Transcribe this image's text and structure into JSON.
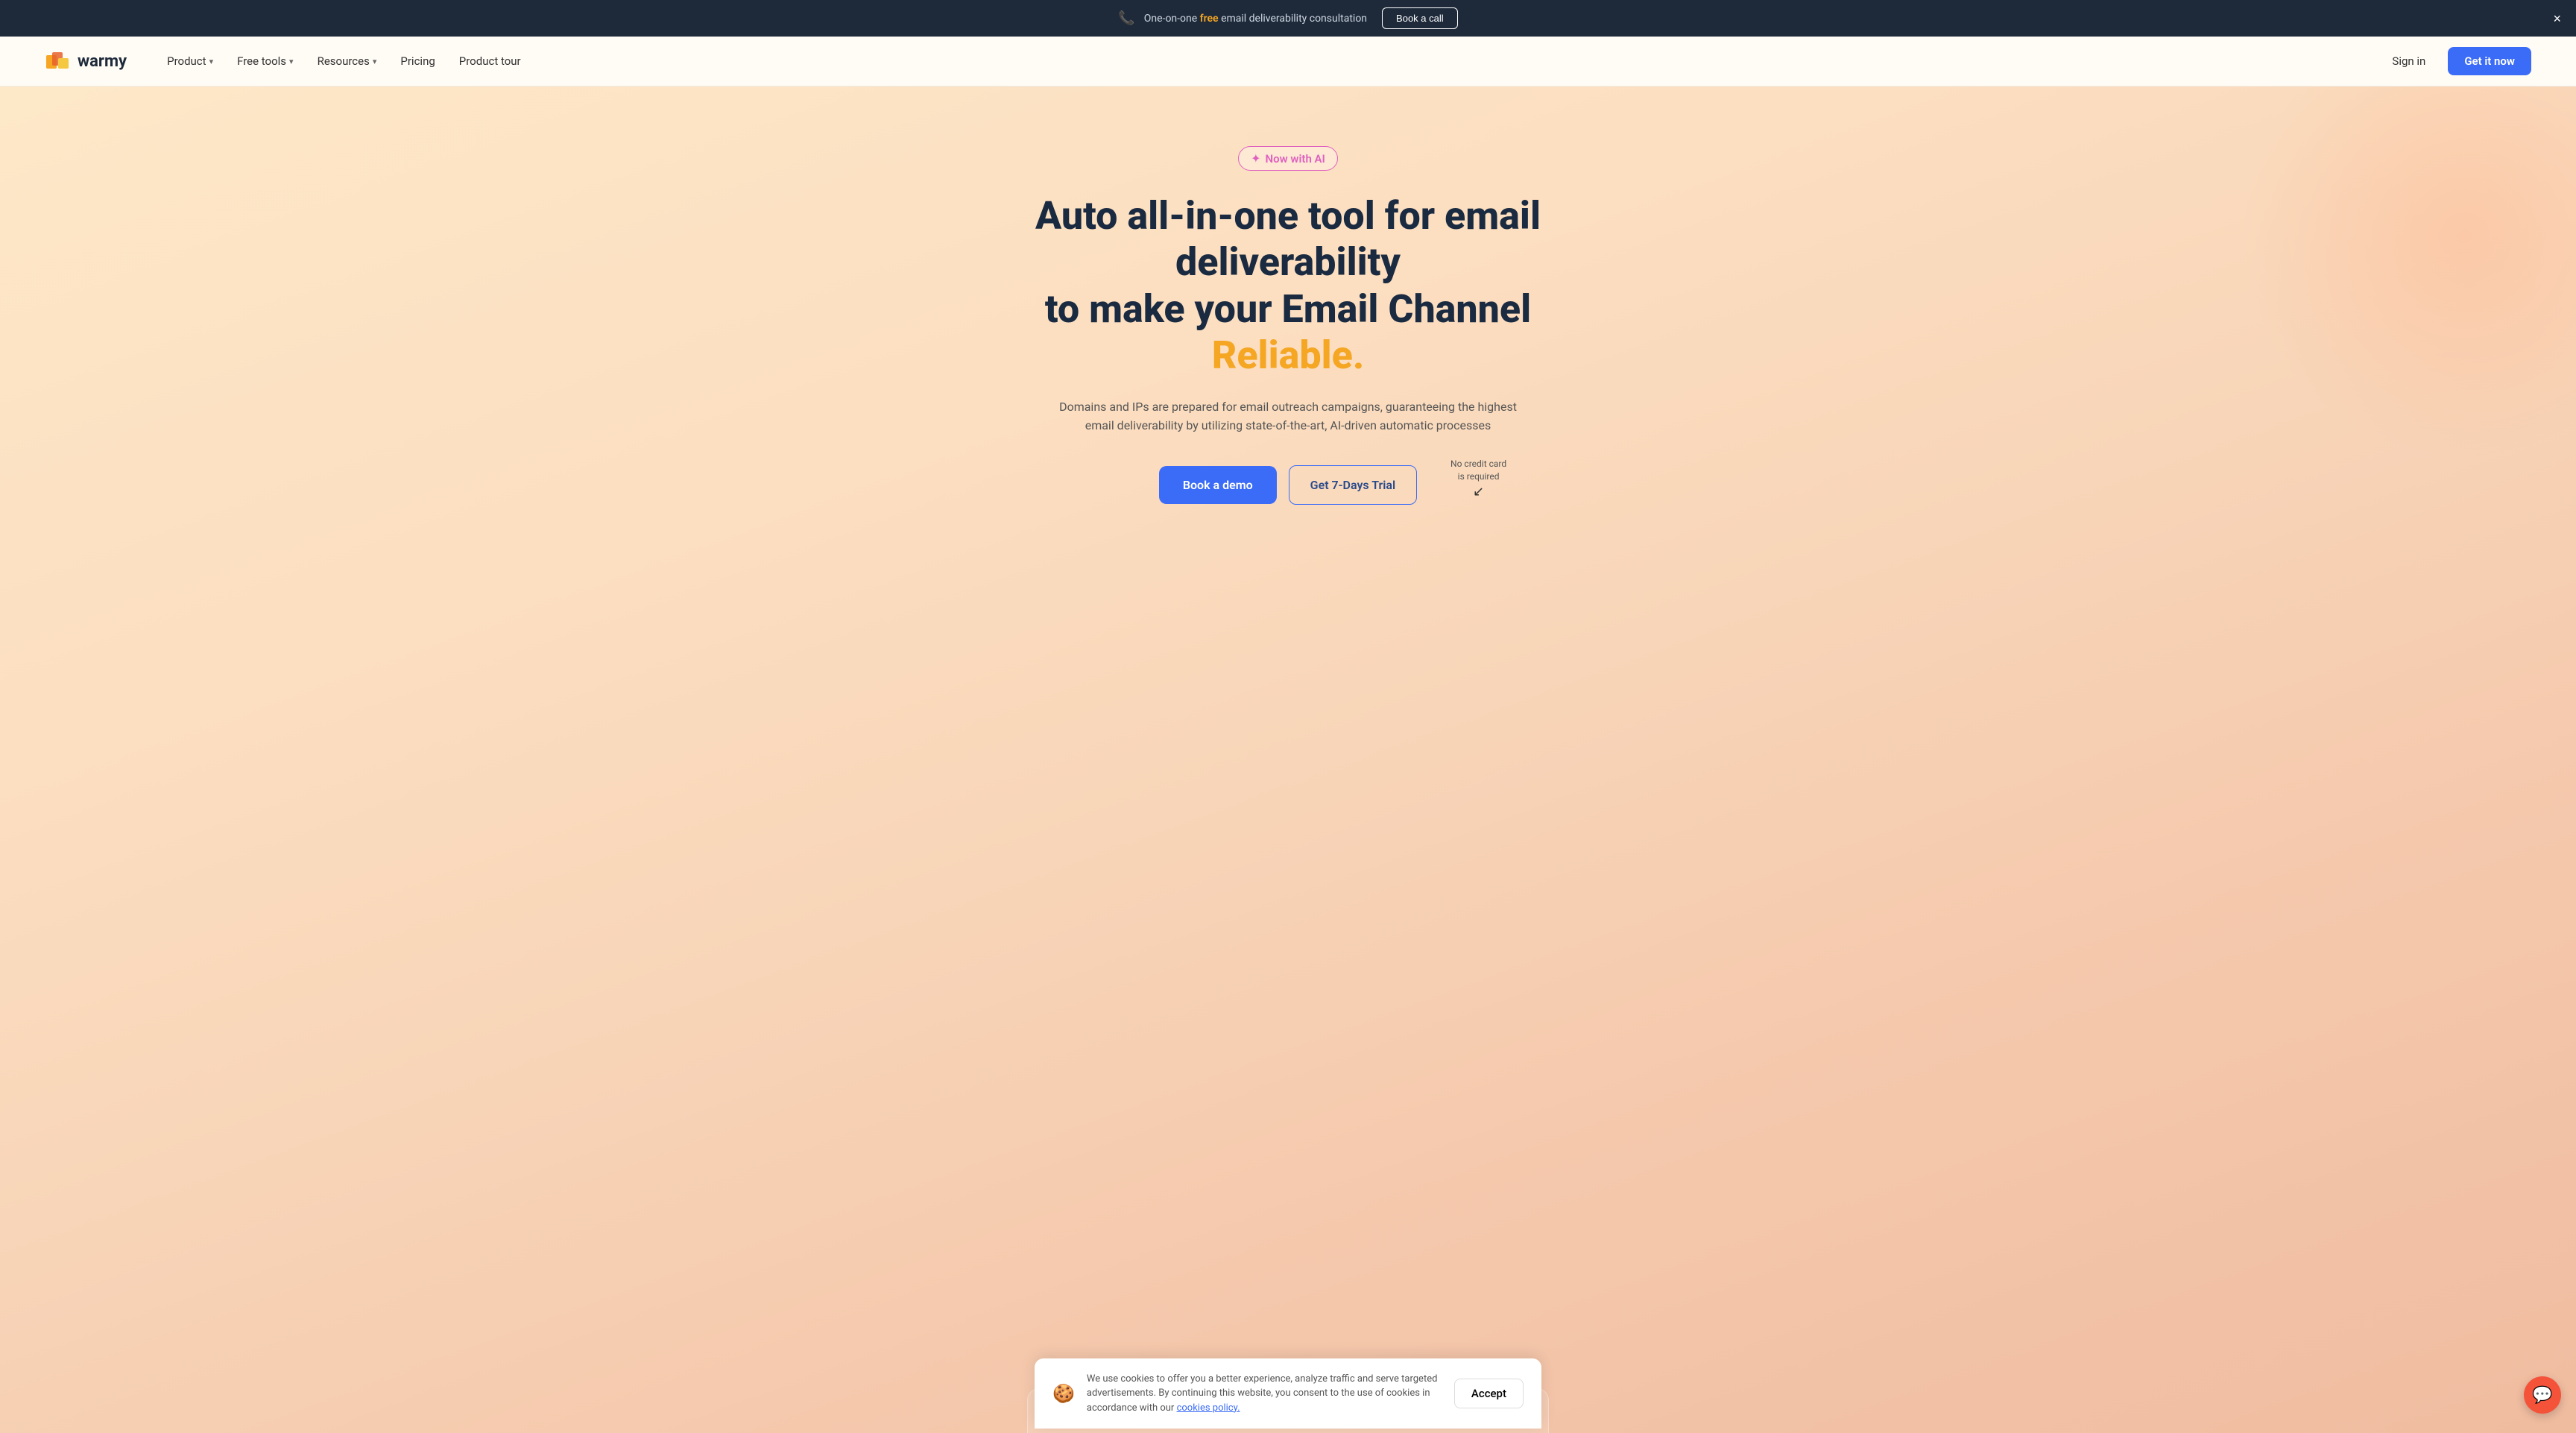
{
  "announcement": {
    "text_before": "One-on-one ",
    "free_word": "free",
    "text_after": " email deliverability consultation",
    "cta_label": "Book a call",
    "close_label": "×"
  },
  "navbar": {
    "logo_text": "warmy",
    "product_label": "Product",
    "free_tools_label": "Free tools",
    "resources_label": "Resources",
    "pricing_label": "Pricing",
    "product_tour_label": "Product tour",
    "sign_in_label": "Sign in",
    "get_it_now_label": "Get it now"
  },
  "hero": {
    "badge_text": "Now with AI",
    "headline_line1": "Auto all-in-one tool for email deliverability",
    "headline_line2_prefix": "to make your Email Channel ",
    "headline_reliable": "Reliable.",
    "subtext": "Domains and IPs are prepared for email outreach campaigns, guaranteeing the highest email deliverability by utilizing state-of-the-art, AI-driven automatic processes",
    "book_demo_label": "Book a demo",
    "trial_label": "Get 7-Days Trial",
    "no_credit_line1": "No credit card",
    "no_credit_line2": "is required"
  },
  "cookie": {
    "text": "We use cookies to offer you a better experience, analyze traffic and serve targeted advertisements. By continuing this website, you consent to the use of cookies in accordance with our ",
    "link_text": "cookies policy.",
    "accept_label": "Accept"
  }
}
